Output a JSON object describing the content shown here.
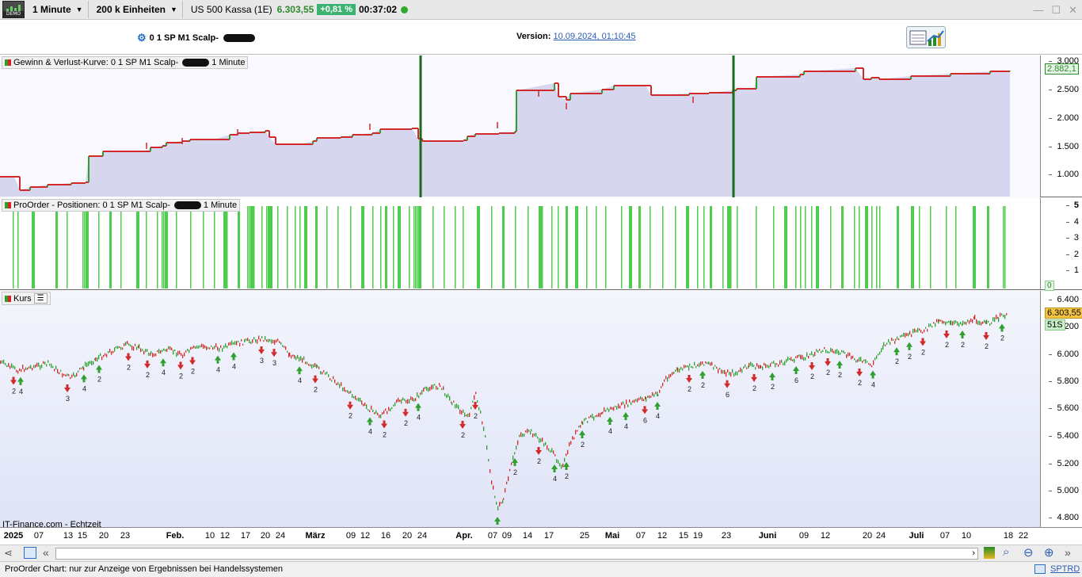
{
  "topbar": {
    "logo_text": "DEMO",
    "timeframe": "1 Minute",
    "units": "200 k Einheiten",
    "instrument": "US 500 Kassa (1E)",
    "price": "6.303,55",
    "change": "+0,81 %",
    "time": "00:37:02",
    "window_buttons": [
      "—",
      "☐",
      "✕"
    ]
  },
  "infobar": {
    "strategy": "0 1 SP M1 Scalp-",
    "version_label": "Version:",
    "version_value": "10.09.2024, 01:10:45"
  },
  "panel_equity": {
    "title": "Gewinn & Verlust-Kurve: 0 1 SP M1 Scalp-",
    "title_suffix": "1 Minute",
    "yticks": [
      "3.000",
      "2.500",
      "2.000",
      "1.500",
      "1.000"
    ],
    "current": "2.882,1"
  },
  "panel_positions": {
    "title": "ProOrder - Positionen: 0 1 SP M1 Scalp-",
    "title_suffix": "1 Minute",
    "yticks": [
      "5",
      "4",
      "3",
      "2",
      "1"
    ],
    "current": "0"
  },
  "panel_price": {
    "title": "Kurs",
    "yticks": [
      "6.400",
      "6.200",
      "6.000",
      "5.800",
      "5.600",
      "5.400",
      "5.200",
      "5.000",
      "4.800"
    ],
    "current": "6.303,55",
    "countdown": "51S",
    "watermark": "IT-Finance.com - Echtzeit"
  },
  "xaxis": {
    "labels": [
      {
        "t": "2025",
        "b": true
      },
      {
        "t": "07"
      },
      {
        "t": "13"
      },
      {
        "t": "15"
      },
      {
        "t": "20"
      },
      {
        "t": "23"
      },
      {
        "t": "Feb.",
        "b": true
      },
      {
        "t": "10"
      },
      {
        "t": "12"
      },
      {
        "t": "17"
      },
      {
        "t": "20"
      },
      {
        "t": "24"
      },
      {
        "t": "März",
        "b": true
      },
      {
        "t": "09"
      },
      {
        "t": "12"
      },
      {
        "t": "16"
      },
      {
        "t": "20"
      },
      {
        "t": "24"
      },
      {
        "t": "Apr.",
        "b": true
      },
      {
        "t": "07"
      },
      {
        "t": "09"
      },
      {
        "t": "14"
      },
      {
        "t": "17"
      },
      {
        "t": "25"
      },
      {
        "t": "Mai",
        "b": true
      },
      {
        "t": "07"
      },
      {
        "t": "12"
      },
      {
        "t": "15"
      },
      {
        "t": "19"
      },
      {
        "t": "23"
      },
      {
        "t": "Juni",
        "b": true
      },
      {
        "t": "09"
      },
      {
        "t": "12"
      },
      {
        "t": "20"
      },
      {
        "t": "24"
      },
      {
        "t": "Juli",
        "b": true
      },
      {
        "t": "07"
      },
      {
        "t": "10"
      },
      {
        "t": "18"
      },
      {
        "t": "22"
      }
    ]
  },
  "statusbar": {
    "text": "ProOrder Chart: nur zur Anzeige von Ergebnissen bei Handelssystemen",
    "right": "SPTRD"
  },
  "colors": {
    "equity_line_up": "#2fa02f",
    "equity_line_down": "#d22a2a",
    "equity_fill": "#d6d6ee",
    "position_bar": "#4fcc4f",
    "price_up": "#2fa02f",
    "price_down": "#d22a2a",
    "current_price_tag": "#f5c542"
  }
}
